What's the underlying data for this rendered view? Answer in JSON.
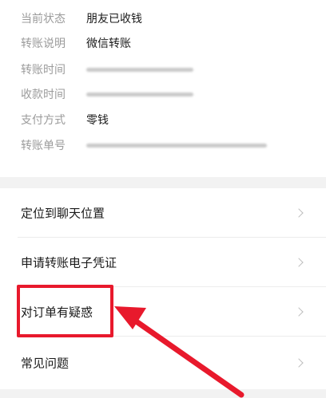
{
  "details": [
    {
      "label": "当前状态",
      "value": "朋友已收钱",
      "blurred": false
    },
    {
      "label": "转账说明",
      "value": "微信转账",
      "blurred": false
    },
    {
      "label": "转账时间",
      "value": "",
      "blurred": true
    },
    {
      "label": "收款时间",
      "value": "",
      "blurred": true
    },
    {
      "label": "支付方式",
      "value": "零钱",
      "blurred": false
    },
    {
      "label": "转账单号",
      "value": "",
      "blurred": true
    }
  ],
  "menu": [
    {
      "label": "定位到聊天位置"
    },
    {
      "label": "申请转账电子凭证"
    },
    {
      "label": "对订单有疑惑"
    },
    {
      "label": "常见问题"
    }
  ],
  "colors": {
    "annotation": "#e8192c",
    "label": "#9b9b9b",
    "value": "#1a1a1a",
    "separator": "#f2f2f2"
  },
  "icons": {
    "menu_chevron": "chevron-right-icon",
    "annotation": "arrow-annotation-icon"
  }
}
